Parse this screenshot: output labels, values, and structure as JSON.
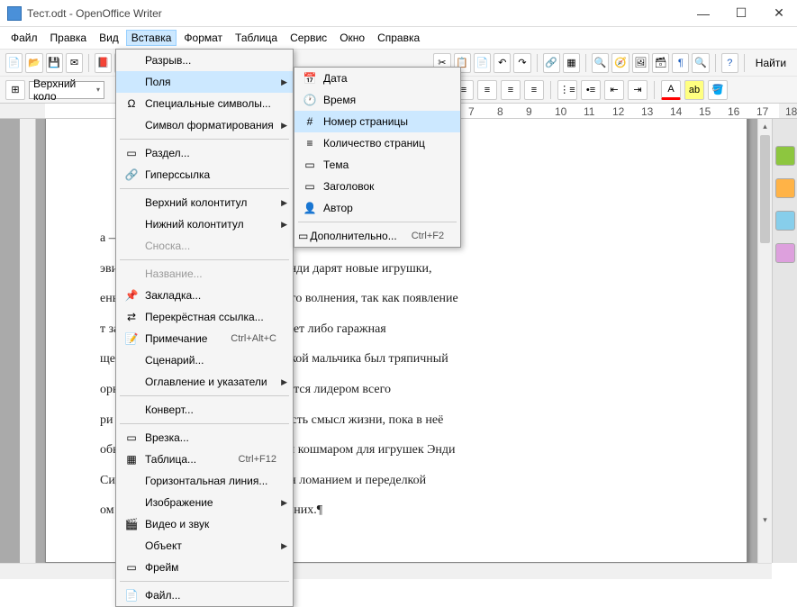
{
  "window": {
    "title": "Тест.odt - OpenOffice Writer",
    "app_icon": "writer-document-icon"
  },
  "menubar": {
    "items": [
      "Файл",
      "Правка",
      "Вид",
      "Вставка",
      "Формат",
      "Таблица",
      "Сервис",
      "Окно",
      "Справка"
    ],
    "active_index": 3
  },
  "toolbar1": {
    "find_label": "Найти"
  },
  "toolbar2": {
    "style": "Верхний коло"
  },
  "insert_menu": {
    "items": [
      {
        "icon": "",
        "label": "Разрыв...",
        "sep_after": false
      },
      {
        "icon": "",
        "label": "Поля",
        "sub": true,
        "highlight": true
      },
      {
        "icon": "Ω",
        "label": "Специальные символы...",
        "sep_after": false
      },
      {
        "icon": "",
        "label": "Символ форматирования",
        "sub": true,
        "sep_after": true
      },
      {
        "icon": "▭",
        "label": "Раздел..."
      },
      {
        "icon": "🔗",
        "label": "Гиперссылка",
        "sep_after": true
      },
      {
        "icon": "",
        "label": "Верхний колонтитул",
        "sub": true
      },
      {
        "icon": "",
        "label": "Нижний колонтитул",
        "sub": true
      },
      {
        "icon": "",
        "label": "Сноска...",
        "disabled": true,
        "sep_after": true
      },
      {
        "icon": "",
        "label": "Название...",
        "disabled": true
      },
      {
        "icon": "📌",
        "label": "Закладка..."
      },
      {
        "icon": "⇄",
        "label": "Перекрёстная ссылка..."
      },
      {
        "icon": "📝",
        "label": "Примечание",
        "shortcut": "Ctrl+Alt+C"
      },
      {
        "icon": "",
        "label": "Сценарий..."
      },
      {
        "icon": "",
        "label": "Оглавление и указатели",
        "sub": true,
        "sep_after": true
      },
      {
        "icon": "",
        "label": "Конверт...",
        "sep_after": true
      },
      {
        "icon": "▭",
        "label": "Врезка..."
      },
      {
        "icon": "▦",
        "label": "Таблица...",
        "shortcut": "Ctrl+F12"
      },
      {
        "icon": "",
        "label": "Горизонтальная линия..."
      },
      {
        "icon": "",
        "label": "Изображение",
        "sub": true
      },
      {
        "icon": "🎬",
        "label": "Видео и звук"
      },
      {
        "icon": "",
        "label": "Объект",
        "sub": true
      },
      {
        "icon": "▭",
        "label": "Фрейм",
        "sep_after": true
      },
      {
        "icon": "📄",
        "label": "Файл..."
      }
    ]
  },
  "fields_menu": {
    "items": [
      {
        "icon": "📅",
        "label": "Дата"
      },
      {
        "icon": "🕐",
        "label": "Время"
      },
      {
        "icon": "#",
        "label": "Номер страницы",
        "highlight": true
      },
      {
        "icon": "≡",
        "label": "Количество страниц"
      },
      {
        "icon": "▭",
        "label": "Тема"
      },
      {
        "icon": "▭",
        "label": "Заголовок"
      },
      {
        "icon": "👤",
        "label": "Автор",
        "sep_after": true
      },
      {
        "icon": "▭",
        "label": "Дополнительно...",
        "shortcut": "Ctrl+F2"
      }
    ]
  },
  "document": {
    "lines": [
      "а — живые игрушки, обитающие в комнате их владельца,",
      "эвис. Ежегодно ко дню рождения Энди дарят новые игрушки,",
      "ень становится источником большого волнения, так как появление",
      "т забвение старой, после чего их ждет либо гаражная",
      "ще с детского сада любимой игрушкой мальчика был тряпичный",
      "орый в своей потайной жизни является лидером всего",
      "ри проповедует то, что у игрушки есть смысл жизни, пока в неё",
      "обви ребенка к игрушке. Ещё одним кошмаром для игрушек Энди",
      "Сид Филлипс, который развлекается ломанием и переделкой",
      "ом является настоящей угрозой для них.¶"
    ]
  },
  "ruler_numbers": [
    "7",
    "8",
    "9",
    "10",
    "11",
    "12",
    "13",
    "14",
    "15",
    "16",
    "17",
    "18"
  ]
}
